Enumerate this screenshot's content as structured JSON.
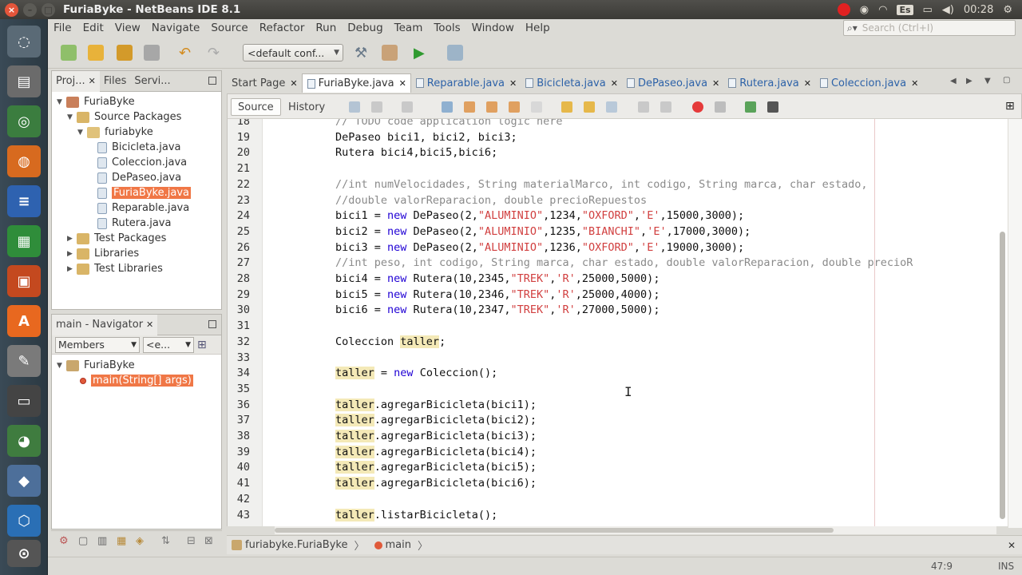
{
  "window": {
    "title": "FuriaByke - NetBeans IDE 8.1"
  },
  "tray": {
    "keyboard": "Es",
    "time": "00:28"
  },
  "menu": [
    "File",
    "Edit",
    "View",
    "Navigate",
    "Source",
    "Refactor",
    "Run",
    "Debug",
    "Team",
    "Tools",
    "Window",
    "Help"
  ],
  "search": {
    "placeholder": "Search (Ctrl+I)"
  },
  "toolbar": {
    "config": "<default conf..."
  },
  "projects": {
    "tabs": [
      "Proj...",
      "Files",
      "Servi..."
    ],
    "tree": [
      {
        "label": "FuriaByke",
        "level": 0,
        "toggle": "▼",
        "kind": "project"
      },
      {
        "label": "Source Packages",
        "level": 1,
        "toggle": "▼",
        "kind": "folder"
      },
      {
        "label": "furiabyke",
        "level": 2,
        "toggle": "▼",
        "kind": "package"
      },
      {
        "label": "Bicicleta.java",
        "level": 3,
        "toggle": "",
        "kind": "java"
      },
      {
        "label": "Coleccion.java",
        "level": 3,
        "toggle": "",
        "kind": "java"
      },
      {
        "label": "DePaseo.java",
        "level": 3,
        "toggle": "",
        "kind": "java"
      },
      {
        "label": "FuriaByke.java",
        "level": 3,
        "toggle": "",
        "kind": "java",
        "selected": true
      },
      {
        "label": "Reparable.java",
        "level": 3,
        "toggle": "",
        "kind": "java"
      },
      {
        "label": "Rutera.java",
        "level": 3,
        "toggle": "",
        "kind": "java"
      },
      {
        "label": "Test Packages",
        "level": 1,
        "toggle": "▶",
        "kind": "folder"
      },
      {
        "label": "Libraries",
        "level": 1,
        "toggle": "▶",
        "kind": "folder"
      },
      {
        "label": "Test Libraries",
        "level": 1,
        "toggle": "▶",
        "kind": "folder"
      }
    ]
  },
  "navigator": {
    "title": "main - Navigator",
    "filter": "Members",
    "filter2": "<e...",
    "tree": [
      {
        "label": "FuriaByke",
        "level": 0,
        "toggle": "▼",
        "kind": "class"
      },
      {
        "label": "main(String[] args)",
        "level": 1,
        "toggle": "",
        "kind": "method",
        "selected": true
      }
    ]
  },
  "editor": {
    "tabs": [
      {
        "label": "Start Page",
        "kind": "start"
      },
      {
        "label": "FuriaByke.java",
        "kind": "java",
        "active": true
      },
      {
        "label": "Reparable.java",
        "kind": "java"
      },
      {
        "label": "Bicicleta.java",
        "kind": "java"
      },
      {
        "label": "DePaseo.java",
        "kind": "java"
      },
      {
        "label": "Rutera.java",
        "kind": "java"
      },
      {
        "label": "Coleccion.java",
        "kind": "java"
      }
    ],
    "source_label": "Source",
    "history_label": "History",
    "lines": [
      {
        "n": "18",
        "tokens": [
          [
            "cm",
            "// TODO code application logic here"
          ]
        ]
      },
      {
        "n": "19",
        "tokens": [
          [
            "",
            "DePaseo bici1, bici2, bici3;"
          ]
        ]
      },
      {
        "n": "20",
        "tokens": [
          [
            "",
            "Rutera bici4,bici5,bici6;"
          ]
        ]
      },
      {
        "n": "21",
        "tokens": []
      },
      {
        "n": "22",
        "tokens": [
          [
            "cm",
            "//int numVelocidades, String materialMarco, int codigo, String marca, char estado,"
          ]
        ]
      },
      {
        "n": "23",
        "tokens": [
          [
            "cm",
            "//double valorReparacion, double precioRepuestos"
          ]
        ]
      },
      {
        "n": "24",
        "tokens": [
          [
            "",
            "bici1 = "
          ],
          [
            "kw",
            "new"
          ],
          [
            "",
            " DePaseo(2,"
          ],
          [
            "str",
            "\"ALUMINIO\""
          ],
          [
            "",
            ",1234,"
          ],
          [
            "str",
            "\"OXFORD\""
          ],
          [
            "",
            ","
          ],
          [
            "str",
            "'E'"
          ],
          [
            "",
            ",15000,3000);"
          ]
        ]
      },
      {
        "n": "25",
        "tokens": [
          [
            "",
            "bici2 = "
          ],
          [
            "kw",
            "new"
          ],
          [
            "",
            " DePaseo(2,"
          ],
          [
            "str",
            "\"ALUMINIO\""
          ],
          [
            "",
            ",1235,"
          ],
          [
            "str",
            "\"BIANCHI\""
          ],
          [
            "",
            ","
          ],
          [
            "str",
            "'E'"
          ],
          [
            "",
            ",17000,3000);"
          ]
        ]
      },
      {
        "n": "26",
        "tokens": [
          [
            "",
            "bici3 = "
          ],
          [
            "kw",
            "new"
          ],
          [
            "",
            " DePaseo(2,"
          ],
          [
            "str",
            "\"ALUMINIO\""
          ],
          [
            "",
            ",1236,"
          ],
          [
            "str",
            "\"OXFORD\""
          ],
          [
            "",
            ","
          ],
          [
            "str",
            "'E'"
          ],
          [
            "",
            ",19000,3000);"
          ]
        ]
      },
      {
        "n": "27",
        "tokens": [
          [
            "cm",
            "//int peso, int codigo, String marca, char estado, double valorReparacion, double precioR"
          ]
        ]
      },
      {
        "n": "28",
        "tokens": [
          [
            "",
            "bici4 = "
          ],
          [
            "kw",
            "new"
          ],
          [
            "",
            " Rutera(10,2345,"
          ],
          [
            "str",
            "\"TREK\""
          ],
          [
            "",
            ","
          ],
          [
            "str",
            "'R'"
          ],
          [
            "",
            ",25000,5000);"
          ]
        ]
      },
      {
        "n": "29",
        "tokens": [
          [
            "",
            "bici5 = "
          ],
          [
            "kw",
            "new"
          ],
          [
            "",
            " Rutera(10,2346,"
          ],
          [
            "str",
            "\"TREK\""
          ],
          [
            "",
            ","
          ],
          [
            "str",
            "'R'"
          ],
          [
            "",
            ",25000,4000);"
          ]
        ]
      },
      {
        "n": "30",
        "tokens": [
          [
            "",
            "bici6 = "
          ],
          [
            "kw",
            "new"
          ],
          [
            "",
            " Rutera(10,2347,"
          ],
          [
            "str",
            "\"TREK\""
          ],
          [
            "",
            ","
          ],
          [
            "str",
            "'R'"
          ],
          [
            "",
            ",27000,5000);"
          ]
        ]
      },
      {
        "n": "31",
        "tokens": []
      },
      {
        "n": "32",
        "tokens": [
          [
            "",
            "Coleccion "
          ],
          [
            "hl",
            "taller"
          ],
          [
            "",
            ";"
          ]
        ]
      },
      {
        "n": "33",
        "tokens": []
      },
      {
        "n": "34",
        "tokens": [
          [
            "hl",
            "taller"
          ],
          [
            "",
            " = "
          ],
          [
            "kw",
            "new"
          ],
          [
            "",
            " Coleccion();"
          ]
        ]
      },
      {
        "n": "35",
        "tokens": []
      },
      {
        "n": "36",
        "tokens": [
          [
            "hl",
            "taller"
          ],
          [
            "",
            ".agregarBicicleta(bici1);"
          ]
        ]
      },
      {
        "n": "37",
        "tokens": [
          [
            "hl",
            "taller"
          ],
          [
            "",
            ".agregarBicicleta(bici2);"
          ]
        ]
      },
      {
        "n": "38",
        "tokens": [
          [
            "hl",
            "taller"
          ],
          [
            "",
            ".agregarBicicleta(bici3);"
          ]
        ]
      },
      {
        "n": "39",
        "tokens": [
          [
            "hl",
            "taller"
          ],
          [
            "",
            ".agregarBicicleta(bici4);"
          ]
        ]
      },
      {
        "n": "40",
        "tokens": [
          [
            "hl",
            "taller"
          ],
          [
            "",
            ".agregarBicicleta(bici5);"
          ]
        ]
      },
      {
        "n": "41",
        "tokens": [
          [
            "hl",
            "taller"
          ],
          [
            "",
            ".agregarBicicleta(bici6);"
          ]
        ]
      },
      {
        "n": "42",
        "tokens": []
      },
      {
        "n": "43",
        "tokens": [
          [
            "hl",
            "taller"
          ],
          [
            "",
            ".listarBicicleta();"
          ]
        ]
      }
    ]
  },
  "breadcrumb": {
    "items": [
      "furiabyke.FuriaByke",
      "main"
    ]
  },
  "status": {
    "position": "47:9",
    "mode": "INS"
  },
  "colors": {
    "selection": "#f07746",
    "keyword": "#1f00d4",
    "string": "#d13f3f",
    "comment": "#8a8a8a",
    "occurrence": "#f4e9b7"
  }
}
